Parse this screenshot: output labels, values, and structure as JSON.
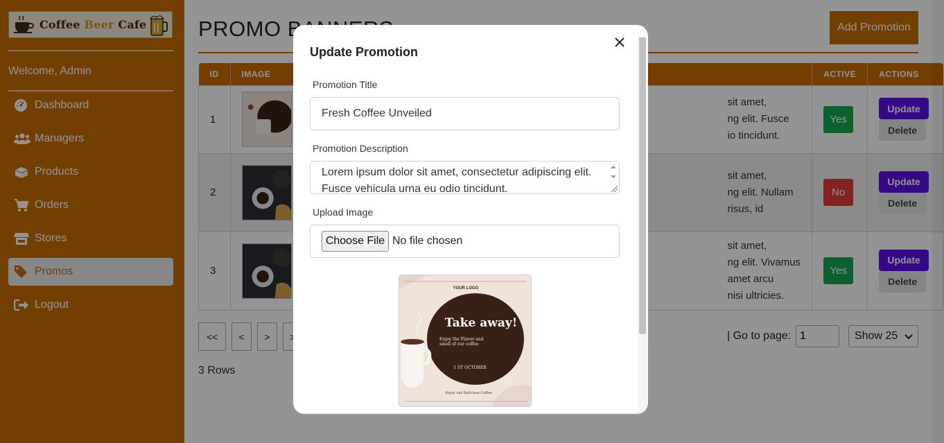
{
  "brand": {
    "name_a": "Coffee ",
    "name_b": "Beer",
    "name_c": " Cafe"
  },
  "sidebar": {
    "welcome": "Welcome, Admin",
    "items": [
      {
        "label": "Dashboard",
        "icon": "gauge-icon",
        "active": false
      },
      {
        "label": "Managers",
        "icon": "users-icon",
        "active": false
      },
      {
        "label": "Products",
        "icon": "box-icon",
        "active": false
      },
      {
        "label": "Orders",
        "icon": "cart-icon",
        "active": false
      },
      {
        "label": "Stores",
        "icon": "store-icon",
        "active": false
      },
      {
        "label": "Promos",
        "icon": "tag-icon",
        "active": true
      },
      {
        "label": "Logout",
        "icon": "logout-icon",
        "active": false
      }
    ]
  },
  "page": {
    "title": "PROMO BANNERS",
    "add_button": "Add Promotion"
  },
  "table": {
    "columns": [
      "ID",
      "IMAGE",
      "",
      "ACTIVE",
      "ACTIONS"
    ],
    "rows": [
      {
        "id": "1",
        "desc": [
          "sit amet,",
          "ng elit. Fusce",
          "io tincidunt."
        ],
        "active": "Yes"
      },
      {
        "id": "2",
        "desc": [
          "sit amet,",
          "ng elit. Nullam",
          "risus, id"
        ],
        "active": "No"
      },
      {
        "id": "3",
        "desc": [
          "sit amet,",
          "ng elit. Vivamus",
          "amet arcu",
          "nisi ultricies."
        ],
        "active": "Yes"
      }
    ],
    "update_label": "Update",
    "delete_label": "Delete"
  },
  "pagination": {
    "first": "<<",
    "prev": "<",
    "next": ">",
    "last": ">",
    "goto_label": "| Go to page:",
    "goto_value": "1",
    "show_label": "Show 25",
    "rows_count": "3 Rows"
  },
  "modal": {
    "title": "Update Promotion",
    "title_label": "Promotion Title",
    "title_value": "Fresh Coffee Unveiled",
    "desc_label": "Promotion Description",
    "desc_line1": "Lorem ipsum dolor sit amet, consectetur adipiscing elit.",
    "desc_line2": "Fusce vehicula urna eu odio tincidunt.",
    "upload_label": "Upload Image",
    "choose_file": "Choose File",
    "no_file": "No file chosen",
    "preview": {
      "logo": "YOUR LOGO",
      "headline": "Take away!",
      "sub1": "Enjoy the Flavor and",
      "sub2": "smell of our coffee",
      "date": "1 ST OCTOBER",
      "footer": "Enjoy our Delicious Coffee"
    }
  },
  "colors": {
    "accent": "#c66d00",
    "update": "#5c10e6",
    "yes": "#1aa653",
    "no": "#e03b3b"
  }
}
